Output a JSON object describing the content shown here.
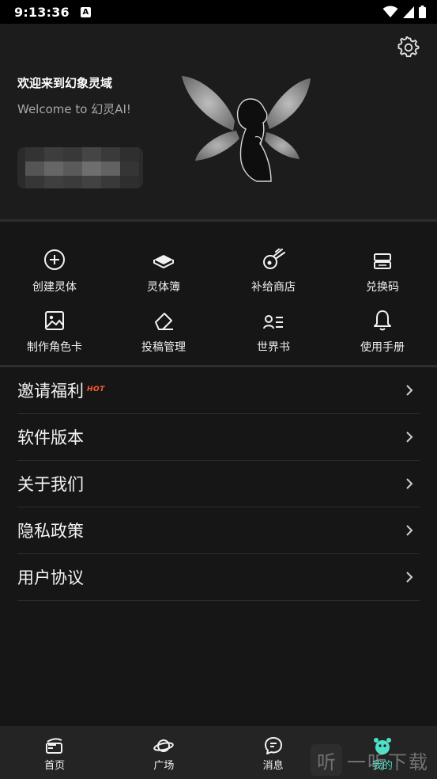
{
  "status_bar": {
    "time": "9:13:36",
    "notification_badge": "A"
  },
  "header": {
    "title": "欢迎来到幻象灵域",
    "subtitle": "Welcome to 幻灵AI!"
  },
  "grid": [
    {
      "label": "创建灵体",
      "icon": "plus-circle-icon"
    },
    {
      "label": "灵体簿",
      "icon": "book-stack-icon"
    },
    {
      "label": "补给商店",
      "icon": "meteor-icon"
    },
    {
      "label": "兑换码",
      "icon": "ticket-icon"
    },
    {
      "label": "制作角色卡",
      "icon": "image-icon"
    },
    {
      "label": "投稿管理",
      "icon": "eraser-icon"
    },
    {
      "label": "世界书",
      "icon": "contacts-list-icon"
    },
    {
      "label": "使用手册",
      "icon": "bell-icon"
    }
  ],
  "menu": [
    {
      "label": "邀请福利",
      "badge": "HOT"
    },
    {
      "label": "软件版本"
    },
    {
      "label": "关于我们"
    },
    {
      "label": "隐私政策"
    },
    {
      "label": "用户协议"
    }
  ],
  "tabs": [
    {
      "label": "首页",
      "icon": "home-icon",
      "active": false
    },
    {
      "label": "广场",
      "icon": "planet-icon",
      "active": false
    },
    {
      "label": "消息",
      "icon": "message-icon",
      "active": false
    },
    {
      "label": "我的",
      "icon": "mine-avatar-icon",
      "active": true
    }
  ],
  "watermark": {
    "glyph": "听",
    "text": "一听下载"
  },
  "colors": {
    "accent": "#4fe0c8",
    "hot": "#ff5a36",
    "background": "#161617"
  }
}
